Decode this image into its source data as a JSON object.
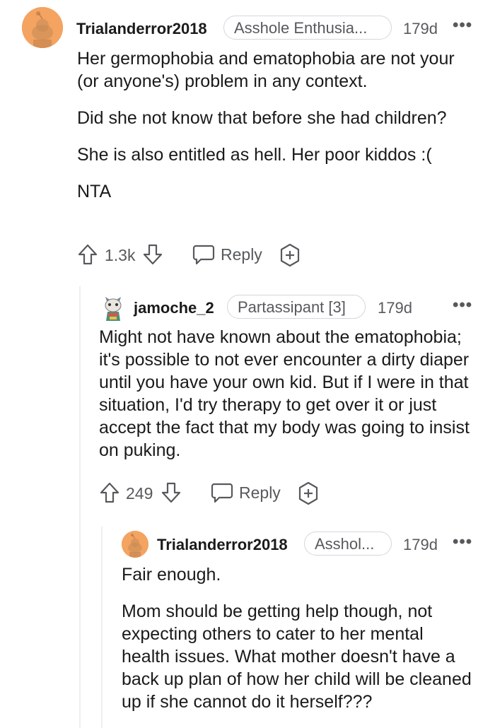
{
  "comments": [
    {
      "username": "Trialanderror2018",
      "flair": "Asshole Enthusia...",
      "time": "179d",
      "paragraphs": [
        "Her germophobia and ematophobia are not your (or anyone's) problem in any context.",
        "Did she not know that before she had children?",
        "She is also entitled as hell. Her poor kiddos :(",
        "NTA"
      ],
      "votes": "1.3k",
      "reply_label": "Reply"
    },
    {
      "username": "jamoche_2",
      "flair": "Partassipant [3]",
      "time": "179d",
      "paragraphs": [
        "Might not have known about the ematophobia; it's possible to not ever encounter a dirty diaper until you have your own kid. But if I were in that situation, I'd try therapy to get over it or just accept the fact that my body was going to insist on puking."
      ],
      "votes": "249",
      "reply_label": "Reply"
    },
    {
      "username": "Trialanderror2018",
      "flair": "Asshol...",
      "time": "179d",
      "paragraphs": [
        "Fair enough.",
        "Mom should be getting help though, not expecting others to cater to her mental health issues. What mother doesn't have a back up plan of how her child will be cleaned up if she cannot do it herself???"
      ]
    }
  ],
  "icons": {
    "avatar": "snoo-avatar-icon",
    "avatar_custom": "custom-avatar-icon",
    "upvote": "upvote-arrow-icon",
    "downvote": "downvote-arrow-icon",
    "reply": "speech-bubble-icon",
    "award": "award-plus-icon",
    "more": "ellipsis-icon"
  },
  "colors": {
    "avatar_bg": "#f4a361",
    "meta_text": "#57595c",
    "thread_line": "#edeff1"
  }
}
